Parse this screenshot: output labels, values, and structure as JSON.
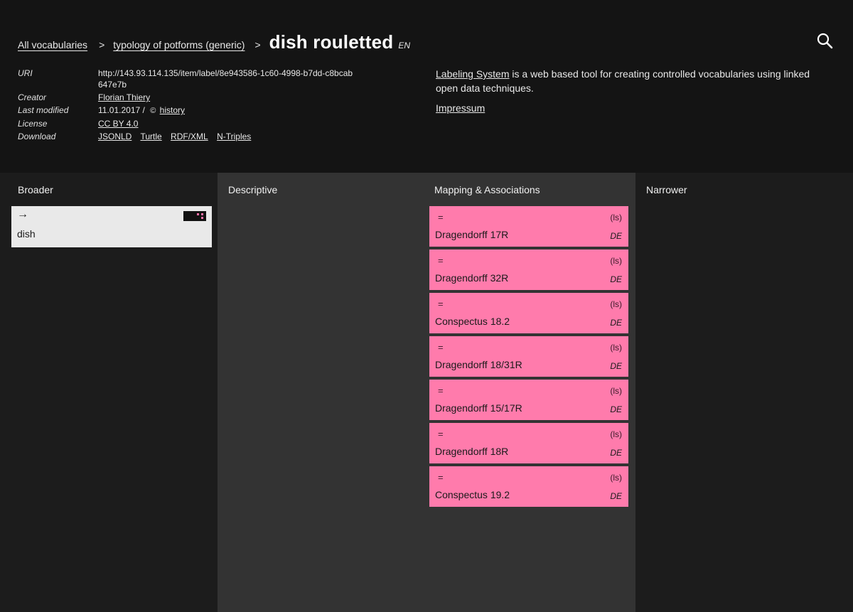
{
  "breadcrumb": {
    "all": "All vocabularies",
    "sep": ">",
    "vocabulary": "typology of potforms (generic)",
    "title": "dish rouletted",
    "lang": "EN"
  },
  "meta": {
    "uri_key": "URI",
    "uri": "http://143.93.114.135/item/label/8e943586-1c60-4998-b7dd-c8bcab647e7b",
    "creator_key": "Creator",
    "creator": "Florian Thiery",
    "modified_key": "Last modified",
    "modified": "11.01.2017 /",
    "history": "history",
    "license_key": "License",
    "license": "CC BY 4.0",
    "download_key": "Download",
    "downloads": [
      "JSONLD",
      "Turtle",
      "RDF/XML",
      "N-Triples"
    ]
  },
  "about": {
    "link": "Labeling System",
    "text": " is a web based tool for creating controlled vocabularies using linked open data techniques.",
    "impressum": "Impressum"
  },
  "columns": {
    "broader": "Broader",
    "descriptive": "Descriptive",
    "mapping": "Mapping & Associations",
    "narrower": "Narrower"
  },
  "broader": {
    "arrow": "→",
    "label": "dish",
    "icon": "vocabulary-badge-icon"
  },
  "mappings": [
    {
      "relation": "=",
      "source": "(ls)",
      "label": "Dragendorff 17R",
      "lang": "DE"
    },
    {
      "relation": "=",
      "source": "(ls)",
      "label": "Dragendorff 32R",
      "lang": "DE"
    },
    {
      "relation": "=",
      "source": "(ls)",
      "label": "Conspectus 18.2",
      "lang": "DE"
    },
    {
      "relation": "=",
      "source": "(ls)",
      "label": "Dragendorff 18/31R",
      "lang": "DE"
    },
    {
      "relation": "=",
      "source": "(ls)",
      "label": "Dragendorff 15/17R",
      "lang": "DE"
    },
    {
      "relation": "=",
      "source": "(ls)",
      "label": "Dragendorff 18R",
      "lang": "DE"
    },
    {
      "relation": "=",
      "source": "(ls)",
      "label": "Conspectus 19.2",
      "lang": "DE"
    }
  ],
  "colors": {
    "header_bg": "#141414",
    "column_dark": "#1c1c1c",
    "column_mid": "#333333",
    "mapping_card": "#ff7bac",
    "broader_card": "#e9e9e9"
  }
}
